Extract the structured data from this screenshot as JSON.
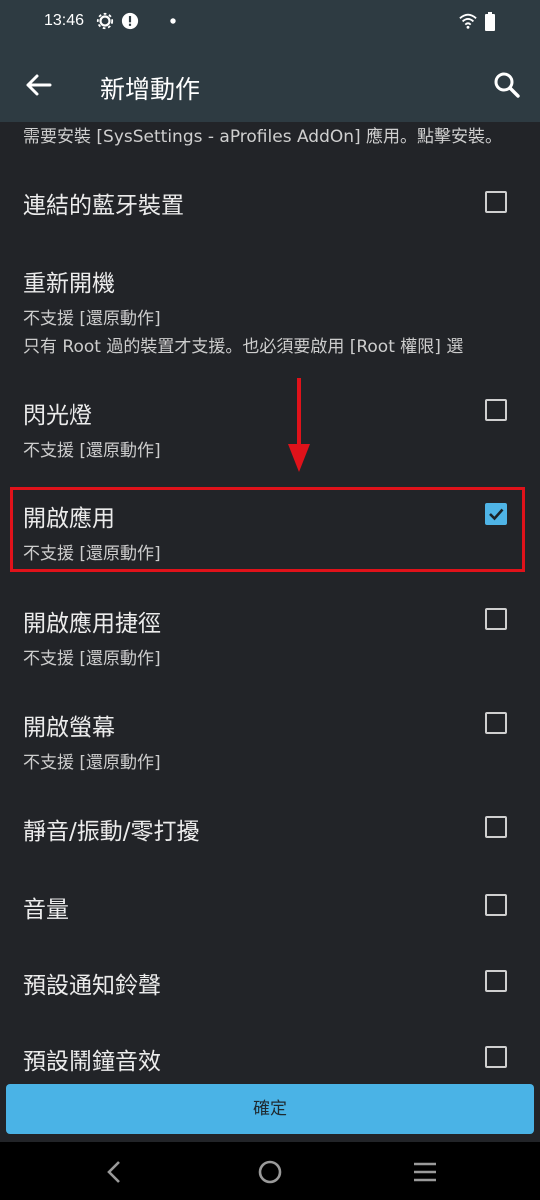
{
  "status": {
    "time": "13:46",
    "left_icons": [
      "settings-gear-icon",
      "alert-icon",
      "dot-icon"
    ],
    "right_icons": [
      "wifi-icon",
      "battery-icon"
    ]
  },
  "app_bar": {
    "title": "新增動作",
    "back_icon": "arrow-left-icon",
    "search_icon": "search-icon"
  },
  "notice": "需要安裝 [SysSettings - aProfiles AddOn] 應用。點擊安裝。",
  "items": [
    {
      "title": "連結的藍牙裝置",
      "sub": [],
      "checkbox": true,
      "checked": false
    },
    {
      "title": "重新開機",
      "sub": [
        "不支援 [還原動作]",
        "只有 Root 過的裝置才支援。也必須要啟用 [Root 權限] 選"
      ],
      "checkbox": false,
      "checked": false
    },
    {
      "title": "閃光燈",
      "sub": [
        "不支援 [還原動作]"
      ],
      "checkbox": true,
      "checked": false
    },
    {
      "title": "開啟應用",
      "sub": [
        "不支援 [還原動作]"
      ],
      "checkbox": true,
      "checked": true
    },
    {
      "title": "開啟應用捷徑",
      "sub": [
        "不支援 [還原動作]"
      ],
      "checkbox": true,
      "checked": false
    },
    {
      "title": "開啟螢幕",
      "sub": [
        "不支援 [還原動作]"
      ],
      "checkbox": true,
      "checked": false
    },
    {
      "title": "靜音/振動/零打擾",
      "sub": [],
      "checkbox": true,
      "checked": false
    },
    {
      "title": "音量",
      "sub": [],
      "checkbox": true,
      "checked": false
    },
    {
      "title": "預設通知鈴聲",
      "sub": [],
      "checkbox": true,
      "checked": false
    },
    {
      "title": "預設鬧鐘音效",
      "sub": [],
      "checkbox": true,
      "checked": false
    }
  ],
  "confirm_label": "確定",
  "nav": [
    "back-triangle-icon",
    "home-circle-icon",
    "recents-menu-icon"
  ],
  "colors": {
    "accent": "#4ab3e6",
    "highlight": "#e0121a",
    "toolbar": "#2e3b42",
    "background": "#222428"
  }
}
